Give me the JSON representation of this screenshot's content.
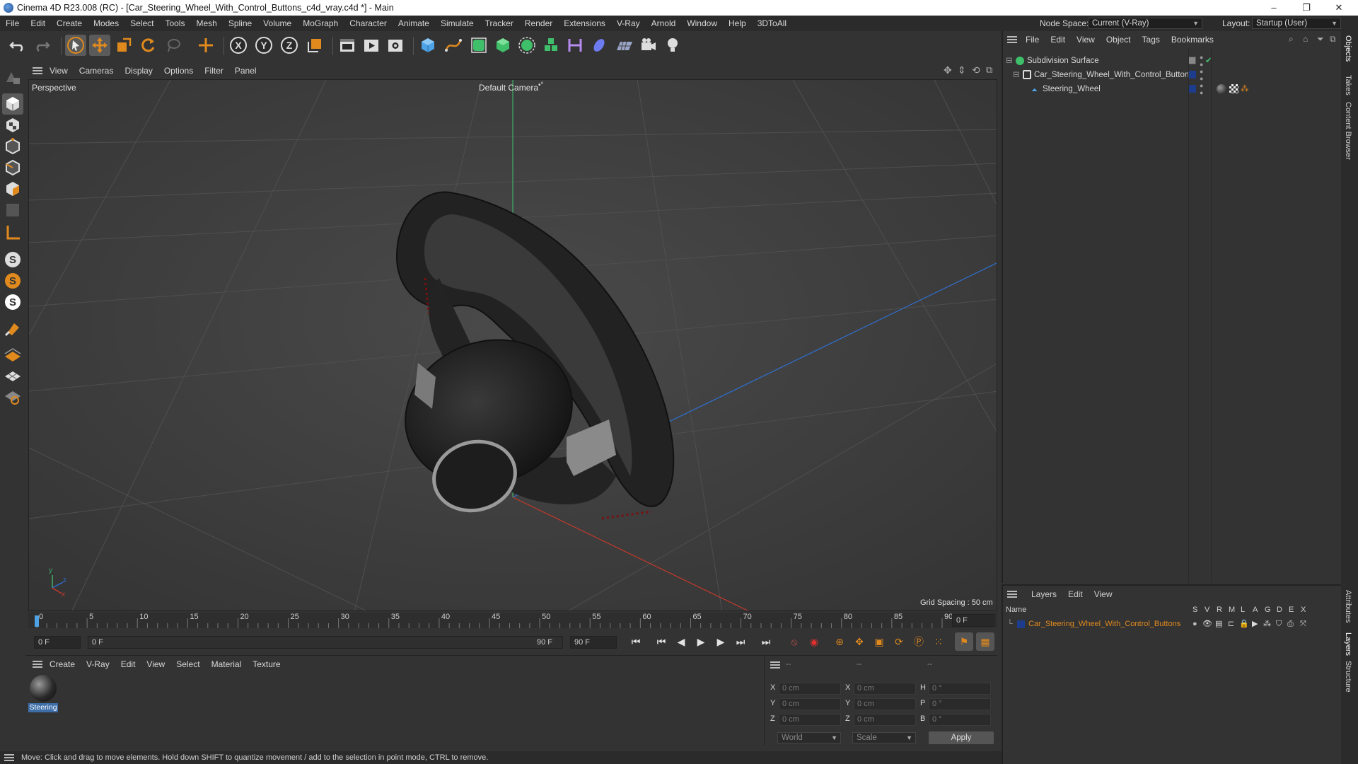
{
  "window": {
    "title": "Cinema 4D R23.008 (RC) - [Car_Steering_Wheel_With_Control_Buttons_c4d_vray.c4d *] - Main",
    "minimize": "–",
    "maximize": "❐",
    "close": "✕"
  },
  "menubar": {
    "items": [
      "File",
      "Edit",
      "Create",
      "Modes",
      "Select",
      "Tools",
      "Mesh",
      "Spline",
      "Volume",
      "MoGraph",
      "Character",
      "Animate",
      "Simulate",
      "Tracker",
      "Render",
      "Extensions",
      "V-Ray",
      "Arnold",
      "Window",
      "Help",
      "3DToAll"
    ],
    "node_space_label": "Node Space:",
    "node_space_value": "Current (V-Ray)",
    "layout_label": "Layout:",
    "layout_value": "Startup (User)"
  },
  "viewport": {
    "menu": [
      "View",
      "Cameras",
      "Display",
      "Options",
      "Filter",
      "Panel"
    ],
    "view_name": "Perspective",
    "camera_name": "Default Camera",
    "camera_suffix": "•°",
    "grid_spacing": "Grid Spacing : 50 cm",
    "axis_y": "y",
    "axis_z": "z",
    "axis_x": "x"
  },
  "timeline": {
    "ticks": [
      "0",
      "5",
      "10",
      "15",
      "20",
      "25",
      "30",
      "35",
      "40",
      "45",
      "50",
      "55",
      "60",
      "65",
      "70",
      "75",
      "80",
      "85",
      "90"
    ],
    "current_frame_right": "0 F",
    "start_field": "0 F",
    "range_start": "0 F",
    "range_end": "90 F",
    "end_field": "90 F"
  },
  "material_manager": {
    "menu": [
      "Create",
      "V-Ray",
      "Edit",
      "View",
      "Select",
      "Material",
      "Texture"
    ],
    "material_name": "Steering"
  },
  "coordinates": {
    "header": [
      "--",
      "--",
      "--"
    ],
    "x_label": "X",
    "y_label": "Y",
    "z_label": "Z",
    "h_label": "H",
    "p_label": "P",
    "b_label": "B",
    "pos_x": "0 cm",
    "pos_y": "0 cm",
    "pos_z": "0 cm",
    "size_x": "0 cm",
    "size_y": "0 cm",
    "size_z": "0 cm",
    "rot_h": "0 °",
    "rot_p": "0 °",
    "rot_b": "0 °",
    "mode_world": "World",
    "mode_scale": "Scale",
    "apply": "Apply"
  },
  "object_manager": {
    "menu": [
      "File",
      "Edit",
      "View",
      "Object",
      "Tags",
      "Bookmarks"
    ],
    "objects": [
      {
        "name": "Subdivision Surface",
        "depth": 0
      },
      {
        "name": "Car_Steering_Wheel_With_Control_Buttons",
        "depth": 1
      },
      {
        "name": "Steering_Wheel",
        "depth": 2
      }
    ]
  },
  "layer_manager": {
    "menu": [
      "Layers",
      "Edit",
      "View"
    ],
    "name_header": "Name",
    "flag_headers": [
      "S",
      "V",
      "R",
      "M",
      "L",
      "A",
      "G",
      "D",
      "E",
      "X"
    ],
    "layer_name": "Car_Steering_Wheel_With_Control_Buttons",
    "layer_color": "#e08a1e"
  },
  "right_tabs": [
    "Objects",
    "Takes",
    "Content Browser",
    "Attributes",
    "Layers",
    "Structure"
  ],
  "status": "Move: Click and drag to move elements. Hold down SHIFT to quantize movement / add to the selection in point mode, CTRL to remove.",
  "colors": {
    "accent_orange": "#e08a1e",
    "axis_green": "#3fae6a",
    "axis_red": "#c0392b",
    "axis_blue": "#2f6fd0"
  }
}
